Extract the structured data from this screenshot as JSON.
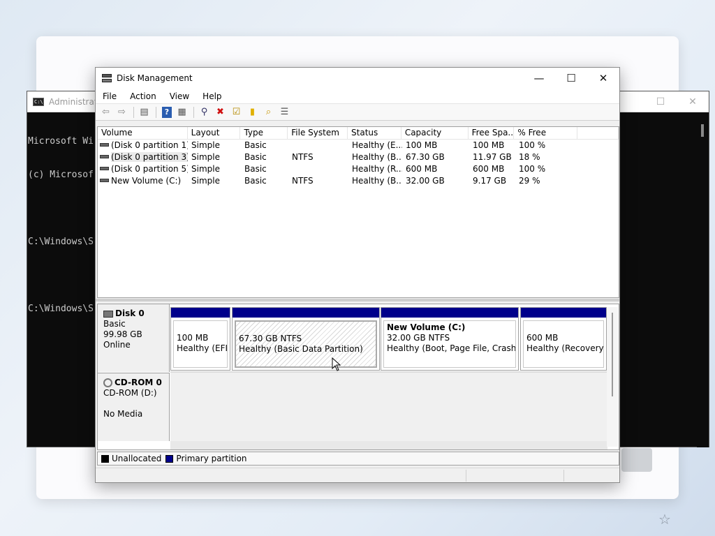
{
  "console": {
    "title": "Administrato",
    "lines": [
      "Microsoft Wi",
      "(c) Microsof",
      "",
      "C:\\Windows\\S",
      "",
      "C:\\Windows\\S"
    ],
    "controls": {
      "maximize": "☐",
      "close": "✕"
    }
  },
  "window": {
    "title": "Disk Management",
    "controls": {
      "minimize": "—",
      "maximize": "☐",
      "close": "✕"
    }
  },
  "menu": [
    "File",
    "Action",
    "View",
    "Help"
  ],
  "toolbar": [
    {
      "icon": "back-arrow-icon",
      "glyph": "⇦"
    },
    {
      "icon": "forward-arrow-icon",
      "glyph": "⇨"
    },
    {
      "icon": "show-hide-console-tree-icon",
      "glyph": "▤"
    },
    {
      "icon": "help-icon",
      "glyph": "?"
    },
    {
      "icon": "properties-icon",
      "glyph": "▦"
    },
    {
      "icon": "connect-icon",
      "glyph": "⚲"
    },
    {
      "icon": "delete-icon",
      "glyph": "✖"
    },
    {
      "icon": "check-icon",
      "glyph": "☑"
    },
    {
      "icon": "open-folder-icon",
      "glyph": "▮"
    },
    {
      "icon": "search-folder-icon",
      "glyph": "⌕"
    },
    {
      "icon": "list-view-icon",
      "glyph": "☰"
    }
  ],
  "volumes": {
    "columns": [
      "Volume",
      "Layout",
      "Type",
      "File System",
      "Status",
      "Capacity",
      "Free Spa...",
      "% Free",
      ""
    ],
    "rows": [
      [
        "(Disk 0 partition 1)",
        "Simple",
        "Basic",
        "",
        "Healthy (E...",
        "100 MB",
        "100 MB",
        "100 %"
      ],
      [
        "(Disk 0 partition 3)",
        "Simple",
        "Basic",
        "NTFS",
        "Healthy (B...",
        "67.30 GB",
        "11.97 GB",
        "18 %"
      ],
      [
        "(Disk 0 partition 5)",
        "Simple",
        "Basic",
        "",
        "Healthy (R...",
        "600 MB",
        "600 MB",
        "100 %"
      ],
      [
        "New Volume (C:)",
        "Simple",
        "Basic",
        "NTFS",
        "Healthy (B...",
        "32.00 GB",
        "9.17 GB",
        "29 %"
      ]
    ]
  },
  "disks": [
    {
      "name": "Disk 0",
      "details": [
        "Basic",
        "99.98 GB",
        "Online"
      ],
      "partitions": [
        {
          "name": "",
          "size": "100 MB",
          "status": "Healthy (EFI S"
        },
        {
          "name": "",
          "size": "67.30 GB NTFS",
          "status": "Healthy (Basic Data Partition)"
        },
        {
          "name": "New Volume  (C:)",
          "size": "32.00 GB NTFS",
          "status": "Healthy (Boot, Page File, Crash Dur"
        },
        {
          "name": "",
          "size": "600 MB",
          "status": "Healthy (Recovery Pa"
        }
      ]
    },
    {
      "name": "CD-ROM 0",
      "details": [
        "CD-ROM (D:)",
        "",
        "No Media"
      ]
    }
  ],
  "legend": [
    {
      "label": "Unallocated",
      "color": "#000000"
    },
    {
      "label": "Primary partition",
      "color": "#00008b"
    }
  ],
  "colors": {
    "primary_partition": "#00008b"
  }
}
